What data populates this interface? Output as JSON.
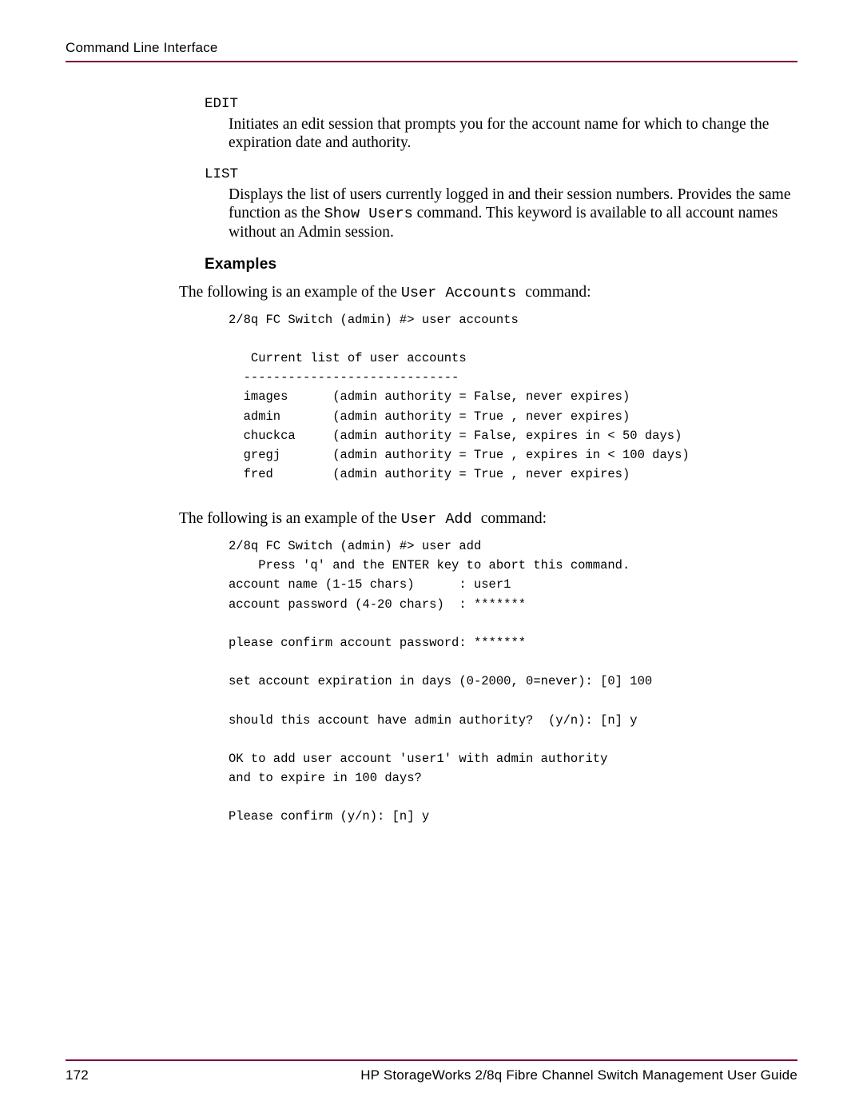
{
  "header": {
    "section_title": "Command Line Interface"
  },
  "keywords": {
    "edit": {
      "term": "EDIT",
      "desc": "Initiates an edit session that prompts you for the account name for which to change the expiration date and authority."
    },
    "list": {
      "term": "LIST",
      "desc_prefix": "Displays the list of users currently logged in and their session numbers. Provides the same function as the ",
      "desc_code": "Show Users",
      "desc_suffix": " command. This keyword is available to all account names without an Admin session."
    }
  },
  "examples": {
    "heading": "Examples",
    "intro1_prefix": "The following is an example of the ",
    "intro1_code": "User Accounts ",
    "intro1_suffix": " command:",
    "code1": "2/8q FC Switch (admin) #> user accounts\n\n   Current list of user accounts\n  -----------------------------\n  images      (admin authority = False, never expires)\n  admin       (admin authority = True , never expires)\n  chuckca     (admin authority = False, expires in < 50 days)\n  gregj       (admin authority = True , expires in < 100 days)\n  fred        (admin authority = True , never expires)",
    "intro2_prefix": "The following is an example of the ",
    "intro2_code": "User Add ",
    "intro2_suffix": " command:",
    "code2": "2/8q FC Switch (admin) #> user add\n    Press 'q' and the ENTER key to abort this command.\naccount name (1-15 chars)      : user1\naccount password (4-20 chars)  : *******\n\nplease confirm account password: *******\n\nset account expiration in days (0-2000, 0=never): [0] 100\n\nshould this account have admin authority?  (y/n): [n] y\n\nOK to add user account 'user1' with admin authority\nand to expire in 100 days?\n\nPlease confirm (y/n): [n] y"
  },
  "footer": {
    "page_number": "172",
    "doc_title": "HP StorageWorks 2/8q Fibre Channel Switch Management User Guide"
  }
}
